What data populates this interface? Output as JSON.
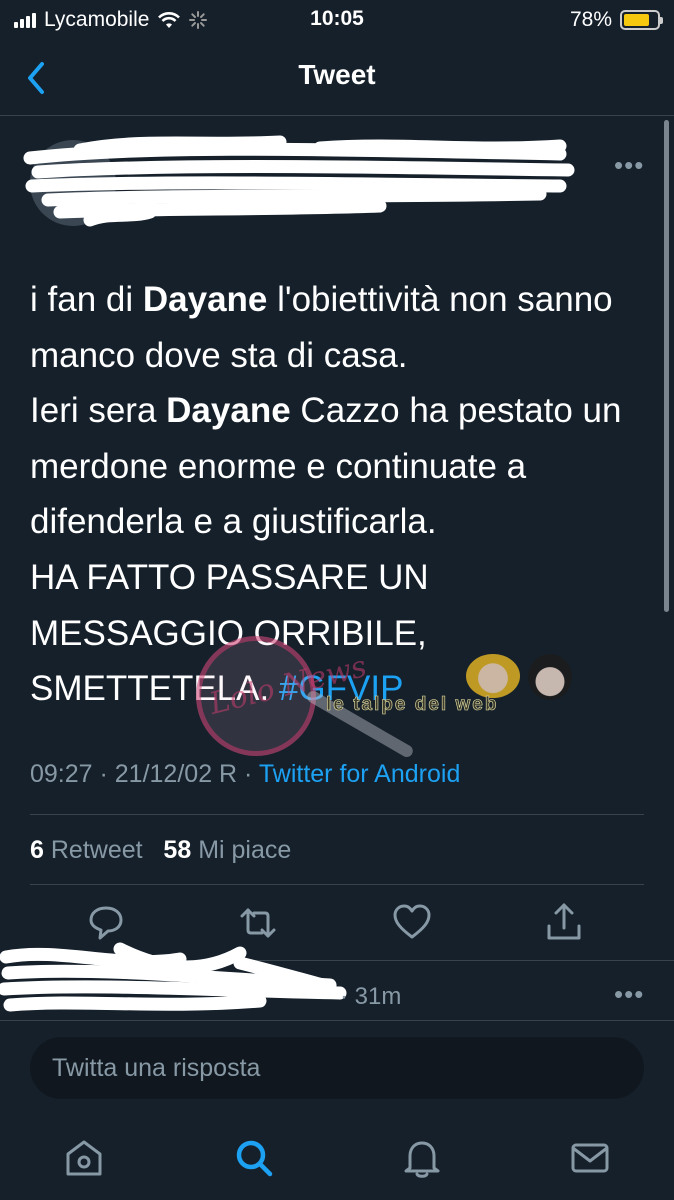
{
  "status_bar": {
    "carrier": "Lycamobile",
    "time": "10:05",
    "battery_percent": "78%",
    "battery_level": 0.78,
    "battery_color": "#f6c90e"
  },
  "header": {
    "title": "Tweet"
  },
  "tweet": {
    "segments": [
      {
        "text": "i fan di ",
        "bold": false
      },
      {
        "text": "Dayane",
        "bold": true
      },
      {
        "text": " l'obiettività non sanno manco dove sta di casa.",
        "bold": false
      },
      {
        "text": "Ieri sera ",
        "bold": false,
        "newline": true
      },
      {
        "text": "Dayane",
        "bold": true
      },
      {
        "text": " Cazzo ha pestato un merdone enorme e continuate a difenderla e a giustificarla.",
        "bold": false
      },
      {
        "text": "HA FATTO PASSARE UN MESSAGGIO ORRIBILE, SMETTETELA.",
        "bold": false,
        "newline": true
      },
      {
        "text": "#GFVIP",
        "bold": false,
        "hashtag": true,
        "space_before": true
      }
    ],
    "timestamp": "09:27 · 21/12/02 R ·",
    "source": "Twitter for Android",
    "retweet_count": "6",
    "retweet_label": "Retweet",
    "like_count": "58",
    "like_label": "Mi piace"
  },
  "reply_preview": {
    "time": "· 31m"
  },
  "composer": {
    "placeholder": "Twitta una risposta"
  },
  "watermark": {
    "text_left": "Lolo News",
    "text_right": "le talpe del web"
  },
  "icons": {
    "back": "chevron-left-icon",
    "more": "more-horizontal-icon",
    "reply": "reply-icon",
    "retweet": "retweet-icon",
    "like": "heart-icon",
    "share": "share-icon",
    "home": "home-icon",
    "search": "search-icon",
    "notifications": "bell-icon",
    "messages": "mail-icon"
  },
  "colors": {
    "background": "#15202b",
    "accent": "#1da1f2",
    "muted": "#8899a6",
    "divider": "#38444d"
  }
}
